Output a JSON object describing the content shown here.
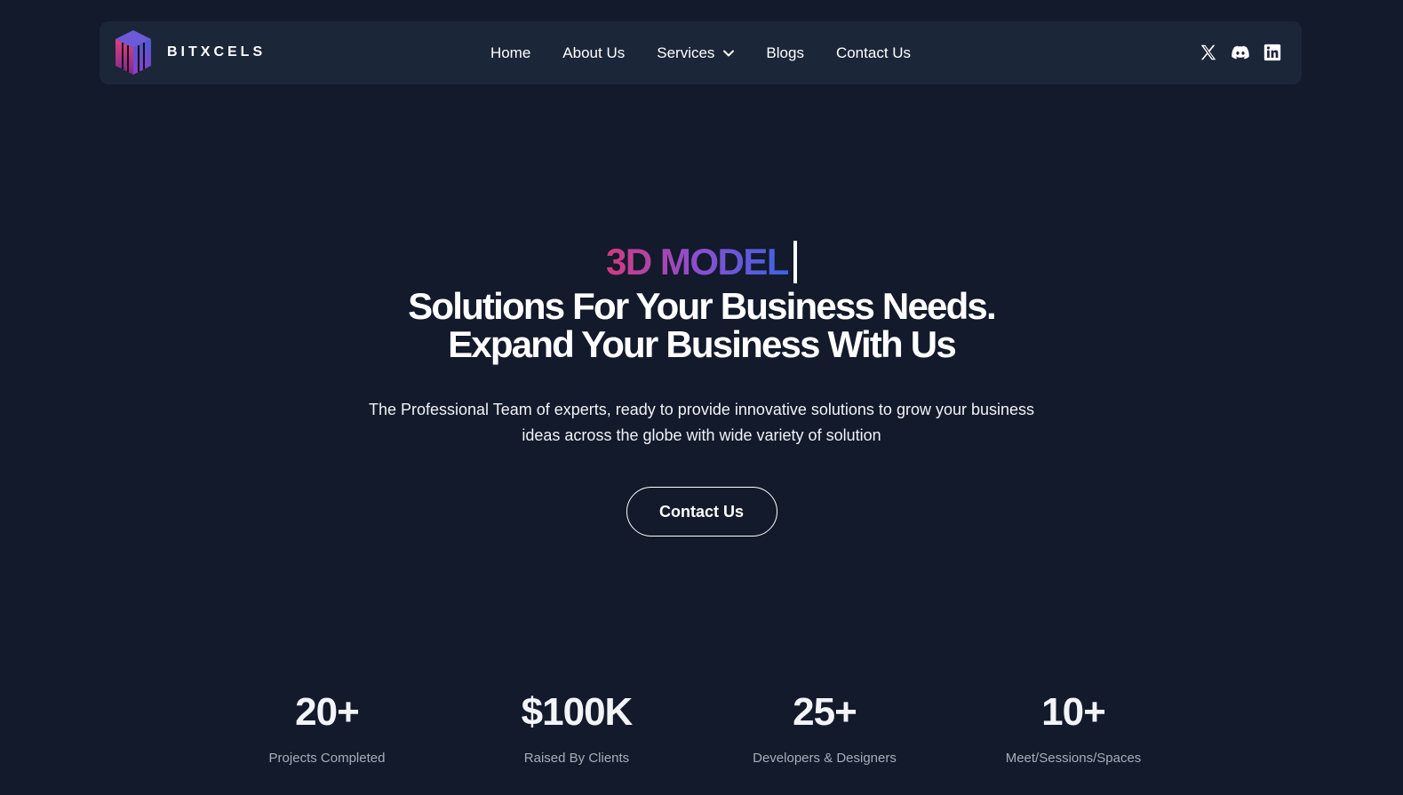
{
  "nav": {
    "brand": "BITXCELS",
    "links": [
      {
        "label": "Home"
      },
      {
        "label": "About Us"
      },
      {
        "label": "Services"
      },
      {
        "label": "Blogs"
      },
      {
        "label": "Contact Us"
      }
    ],
    "socials": [
      "x-icon",
      "discord-icon",
      "linkedin-icon"
    ]
  },
  "hero": {
    "typed_text": "3D MODEL",
    "headline_line1": "Solutions For Your Business Needs.",
    "headline_line2": "Expand Your Business With Us",
    "subtext_line1": "The Professional Team of experts, ready to provide innovative solutions to grow your business",
    "subtext_line2": "ideas across the globe with wide variety of solution",
    "cta_label": "Contact Us"
  },
  "stats": [
    {
      "value": "20+",
      "label": "Projects Completed"
    },
    {
      "value": "$100K",
      "label": "Raised By Clients"
    },
    {
      "value": "25+",
      "label": "Developers & Designers"
    },
    {
      "value": "10+",
      "label": "Meet/Sessions/Spaces"
    }
  ],
  "colors": {
    "background": "#121a2b",
    "navbar": "#1c2639",
    "gradient_start": "#d23a7d",
    "gradient_mid": "#8b4fd0",
    "gradient_end": "#3d63e0"
  }
}
